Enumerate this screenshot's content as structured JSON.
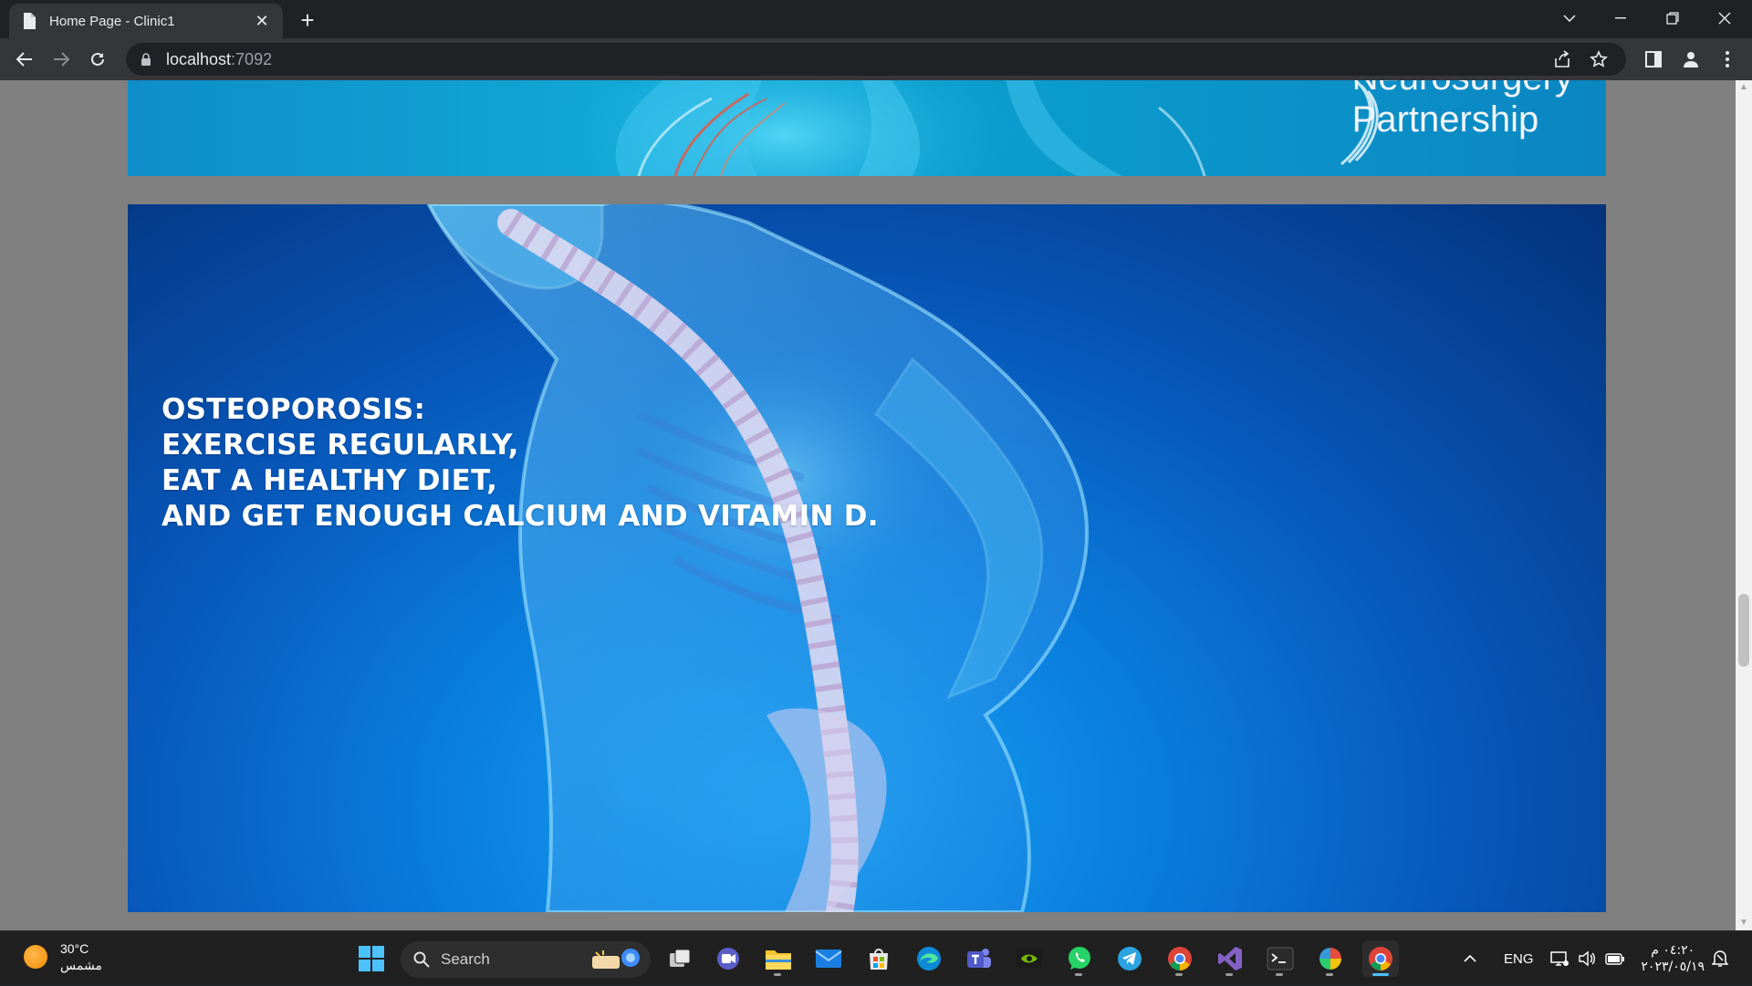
{
  "browser": {
    "tab_title": "Home Page - Clinic1",
    "url_host": "localhost",
    "url_port": ":7092",
    "tab_close": "✕",
    "new_tab": "+"
  },
  "banner": {
    "brand_line1": "Neurosurgery",
    "brand_line2": "Partnership"
  },
  "hero": {
    "lines": [
      "OSTEOPOROSIS:",
      "EXERCISE REGULARLY,",
      "EAT A HEALTHY DIET,",
      "AND GET ENOUGH CALCIUM AND VITAMIN D."
    ]
  },
  "taskbar": {
    "weather_temp": "30°C",
    "weather_desc": "مشمس",
    "search_label": "Search",
    "language": "ENG",
    "time": "٠٤:٢٠ م",
    "date": "٢٠٢٣/٠٥/١٩"
  },
  "colors": {
    "chrome_dark": "#202124",
    "chrome_toolbar": "#35363a",
    "page_bg": "#808080",
    "hero_blue": "#0756b8",
    "taskbar": "#202020",
    "accent": "#4cc2ff"
  },
  "icons": {
    "back": "arrow-left-icon",
    "forward": "arrow-right-icon",
    "reload": "reload-icon",
    "lock": "lock-icon",
    "share": "share-icon",
    "bookmark": "star-icon",
    "side_panel": "side-panel-icon",
    "profile": "profile-icon",
    "menu": "kebab-menu-icon"
  }
}
